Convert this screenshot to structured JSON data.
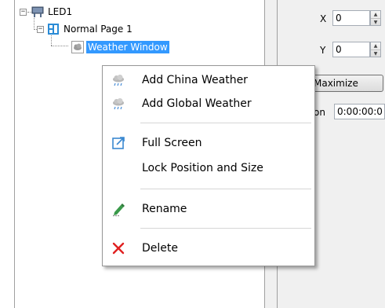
{
  "tree": {
    "nodes": [
      {
        "label": "LED1",
        "icon": "monitor-icon",
        "expander": "−"
      },
      {
        "label": "Normal Page 1",
        "icon": "page-layout-icon",
        "expander": "−"
      },
      {
        "label": "Weather Window",
        "icon": "weather-cloud-icon",
        "selected": true
      }
    ]
  },
  "properties": {
    "x_label": "X",
    "x_value": "0",
    "y_label": "Y",
    "y_value": "0",
    "maximize_label": "Maximize",
    "duration_label_fragment": "on",
    "duration_value": "0:00:00:0"
  },
  "context_menu": {
    "items": [
      {
        "label": "Add China Weather",
        "icon": "cloud-rain-icon"
      },
      {
        "label": "Add Global Weather",
        "icon": "cloud-rain-icon"
      },
      {
        "label": "Full Screen",
        "icon": "fullscreen-icon"
      },
      {
        "label": "Lock Position and Size",
        "icon": ""
      },
      {
        "label": "Rename",
        "icon": "pencil-icon"
      },
      {
        "label": "Delete",
        "icon": "close-x-icon"
      }
    ]
  },
  "colors": {
    "selection": "#3399ff",
    "delete_red": "#e02020",
    "panel_bg": "#f0f0f0"
  }
}
